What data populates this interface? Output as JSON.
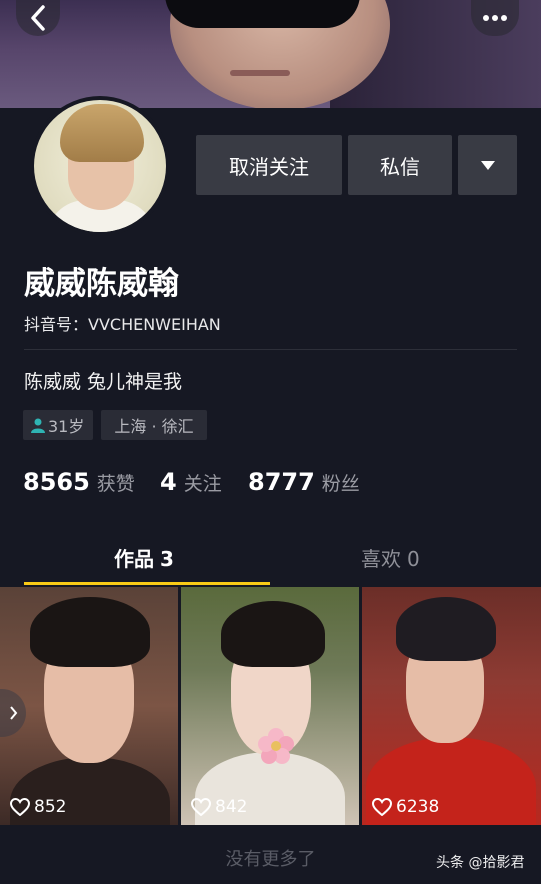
{
  "header": {
    "back_icon": "chevron-left-icon",
    "more_icon": "more-horizontal-icon"
  },
  "profile": {
    "display_name": "威威陈威翰",
    "douyin_id": "抖音号：VVCHENWEIHAN",
    "bio": "陈威威 兔儿神是我",
    "age_tag": "31岁",
    "location_tag": "上海 · 徐汇"
  },
  "actions": {
    "unfollow_label": "取消关注",
    "message_label": "私信",
    "dropdown_icon": "triangle-down-icon"
  },
  "stats": {
    "likes_num": "8565",
    "likes_label": "获赞",
    "following_num": "4",
    "following_label": "关注",
    "fans_num": "8777",
    "fans_label": "粉丝"
  },
  "tabs": [
    {
      "label": "作品",
      "count": "3",
      "active": true
    },
    {
      "label": "喜欢",
      "count": "0",
      "active": false
    }
  ],
  "videos": [
    {
      "likes": "852"
    },
    {
      "likes": "842"
    },
    {
      "likes": "6238"
    }
  ],
  "footer": {
    "no_more": "没有更多了",
    "watermark": "头条 @拾影君"
  },
  "colors": {
    "background": "#161823",
    "button": "#393b44",
    "tab_underline": "#facb17",
    "tag_bg": "#2a2c36"
  }
}
